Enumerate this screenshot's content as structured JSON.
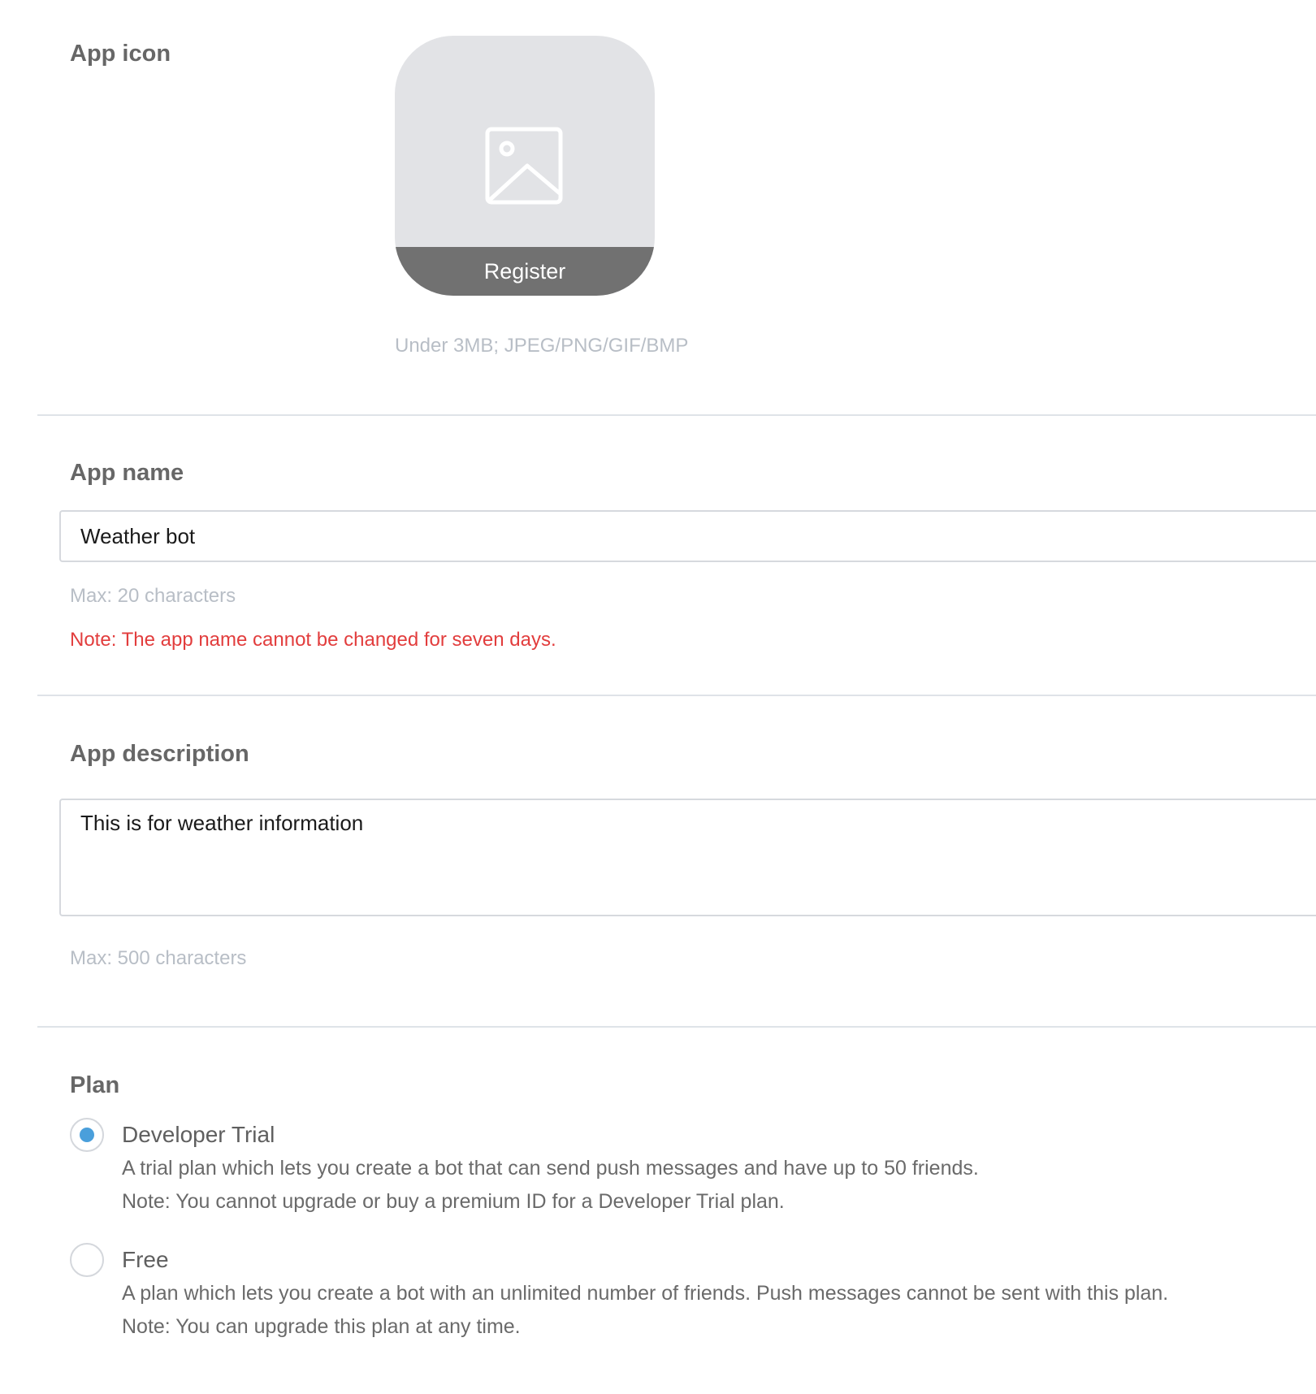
{
  "app_icon": {
    "title": "App icon",
    "register_label": "Register",
    "hint": "Under 3MB; JPEG/PNG/GIF/BMP",
    "placeholder_icon": "image-placeholder-icon"
  },
  "app_name": {
    "title": "App name",
    "value": "Weather bot",
    "hint": "Max: 20 characters",
    "note": "Note: The app name cannot be changed for seven days."
  },
  "app_description": {
    "title": "App description",
    "value": "This is for weather information",
    "hint": "Max: 500 characters"
  },
  "plan": {
    "title": "Plan",
    "selected": "Developer Trial",
    "options": [
      {
        "name": "Developer Trial",
        "desc1": "A trial plan which lets you create a bot that can send push messages and have up to 50 friends.",
        "desc2": "Note: You cannot upgrade or buy a premium ID for a Developer Trial plan."
      },
      {
        "name": "Free",
        "desc1": "A plan which lets you create a bot with an unlimited number of friends. Push messages cannot be sent with this plan.",
        "desc2": "Note: You can upgrade this plan at any time."
      }
    ]
  },
  "colors": {
    "accent": "#4a9fdb",
    "warning": "#e23d3d",
    "register_bar": "#717171",
    "icon_bg": "#e2e3e6"
  }
}
